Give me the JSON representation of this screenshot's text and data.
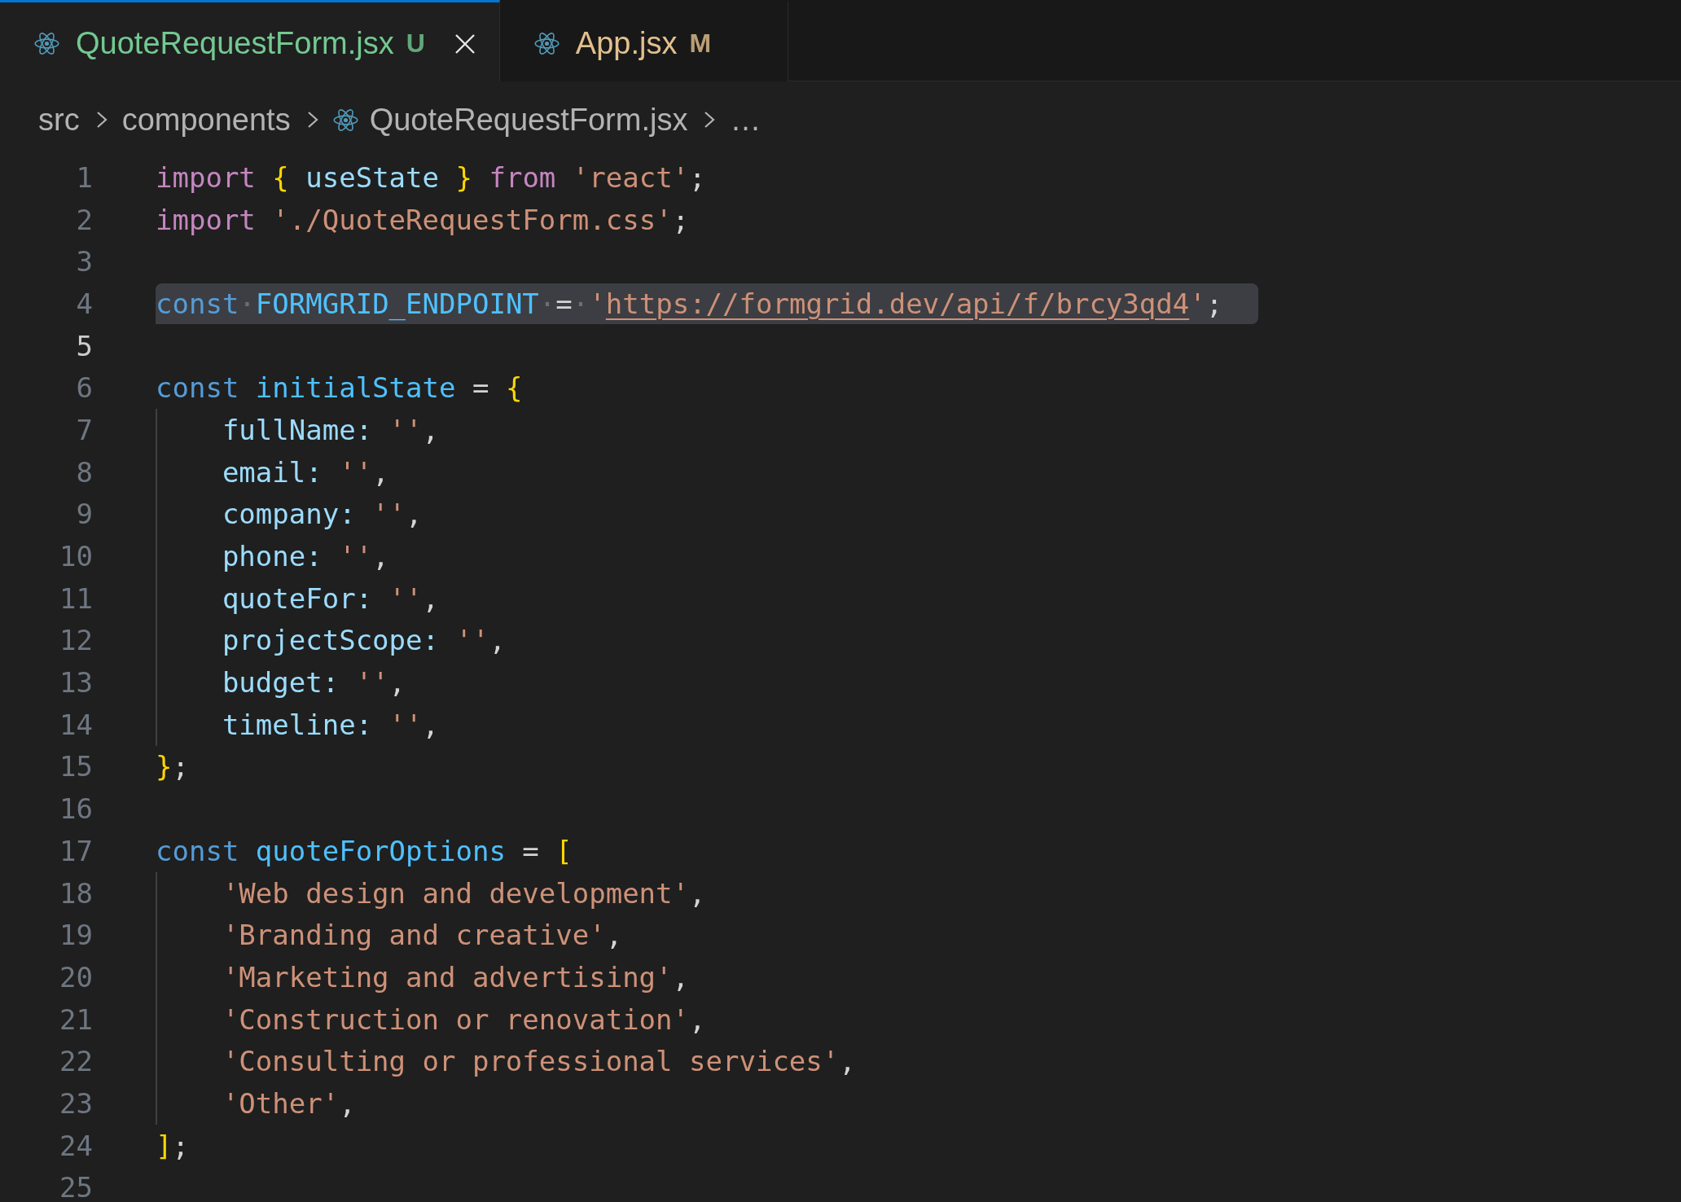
{
  "tabs": [
    {
      "label": "QuoteRequestForm.jsx",
      "status": "U",
      "color": "#73c991",
      "selected": true
    },
    {
      "label": "App.jsx",
      "status": "M",
      "color": "#e2c08d",
      "selected": false
    }
  ],
  "breadcrumb": {
    "items": [
      {
        "kind": "folder",
        "label": "src"
      },
      {
        "kind": "folder",
        "label": "components"
      },
      {
        "kind": "file",
        "label": "QuoteRequestForm.jsx"
      },
      {
        "kind": "symbol",
        "label": "…"
      }
    ]
  },
  "editor": {
    "lines": [
      {
        "number": "1",
        "selected": false,
        "active": false,
        "tokens": [
          {
            "kind": "keyword",
            "text": "import "
          },
          {
            "kind": "brace",
            "text": "{ "
          },
          {
            "kind": "variable",
            "text": "useState "
          },
          {
            "kind": "brace",
            "text": "} "
          },
          {
            "kind": "keyword",
            "text": "from "
          },
          {
            "kind": "string",
            "text": "'react'"
          },
          {
            "kind": "punct",
            "text": ";"
          }
        ]
      },
      {
        "number": "2",
        "selected": false,
        "active": false,
        "tokens": [
          {
            "kind": "keyword",
            "text": "import "
          },
          {
            "kind": "string",
            "text": "'./QuoteRequestForm.css'"
          },
          {
            "kind": "punct",
            "text": ";"
          }
        ]
      },
      {
        "number": "3",
        "selected": false,
        "active": false
      },
      {
        "number": "4",
        "selected": true,
        "active": false,
        "tokens": [
          {
            "kind": "storage",
            "text": "const"
          },
          {
            "kind": "whitespace",
            "text": "·"
          },
          {
            "kind": "constant",
            "text": "FORMGRID_ENDPOINT"
          },
          {
            "kind": "whitespace",
            "text": "·"
          },
          {
            "kind": "punct",
            "text": "="
          },
          {
            "kind": "whitespace",
            "text": "·"
          },
          {
            "kind": "string",
            "text": "'"
          },
          {
            "kind": "link",
            "text": "https://formgrid.dev/api/f/brcy3qd4"
          },
          {
            "kind": "string",
            "text": "'"
          },
          {
            "kind": "punct",
            "text": ";"
          }
        ]
      },
      {
        "number": "5",
        "selected": false,
        "active": true
      },
      {
        "number": "6",
        "selected": false,
        "active": false,
        "tokens": [
          {
            "kind": "storage",
            "text": "const "
          },
          {
            "kind": "constant",
            "text": "initialState"
          },
          {
            "kind": "punct",
            "text": " = "
          },
          {
            "kind": "brace",
            "text": "{"
          }
        ]
      },
      {
        "number": "7",
        "selected": false,
        "active": false,
        "tokens": [
          {
            "kind": "property",
            "text": "    fullName: "
          },
          {
            "kind": "string",
            "text": "''"
          },
          {
            "kind": "punct",
            "text": ","
          }
        ]
      },
      {
        "number": "8",
        "selected": false,
        "active": false,
        "tokens": [
          {
            "kind": "property",
            "text": "    email: "
          },
          {
            "kind": "string",
            "text": "''"
          },
          {
            "kind": "punct",
            "text": ","
          }
        ]
      },
      {
        "number": "9",
        "selected": false,
        "active": false,
        "tokens": [
          {
            "kind": "property",
            "text": "    company: "
          },
          {
            "kind": "string",
            "text": "''"
          },
          {
            "kind": "punct",
            "text": ","
          }
        ]
      },
      {
        "number": "10",
        "selected": false,
        "active": false,
        "tokens": [
          {
            "kind": "property",
            "text": "    phone: "
          },
          {
            "kind": "string",
            "text": "''"
          },
          {
            "kind": "punct",
            "text": ","
          }
        ]
      },
      {
        "number": "11",
        "selected": false,
        "active": false,
        "tokens": [
          {
            "kind": "property",
            "text": "    quoteFor: "
          },
          {
            "kind": "string",
            "text": "''"
          },
          {
            "kind": "punct",
            "text": ","
          }
        ]
      },
      {
        "number": "12",
        "selected": false,
        "active": false,
        "tokens": [
          {
            "kind": "property",
            "text": "    projectScope: "
          },
          {
            "kind": "string",
            "text": "''"
          },
          {
            "kind": "punct",
            "text": ","
          }
        ]
      },
      {
        "number": "13",
        "selected": false,
        "active": false,
        "tokens": [
          {
            "kind": "property",
            "text": "    budget: "
          },
          {
            "kind": "string",
            "text": "''"
          },
          {
            "kind": "punct",
            "text": ","
          }
        ]
      },
      {
        "number": "14",
        "selected": false,
        "active": false,
        "tokens": [
          {
            "kind": "property",
            "text": "    timeline: "
          },
          {
            "kind": "string",
            "text": "''"
          },
          {
            "kind": "punct",
            "text": ","
          }
        ]
      },
      {
        "number": "15",
        "selected": false,
        "active": false,
        "tokens": [
          {
            "kind": "brace",
            "text": "}"
          },
          {
            "kind": "punct",
            "text": ";"
          }
        ]
      },
      {
        "number": "16",
        "selected": false,
        "active": false
      },
      {
        "number": "17",
        "selected": false,
        "active": false,
        "tokens": [
          {
            "kind": "storage",
            "text": "const "
          },
          {
            "kind": "constant",
            "text": "quoteForOptions"
          },
          {
            "kind": "punct",
            "text": " = "
          },
          {
            "kind": "brace",
            "text": "["
          }
        ]
      },
      {
        "number": "18",
        "selected": false,
        "active": false,
        "tokens": [
          {
            "kind": "string",
            "text": "    'Web design and development'"
          },
          {
            "kind": "punct",
            "text": ","
          }
        ]
      },
      {
        "number": "19",
        "selected": false,
        "active": false,
        "tokens": [
          {
            "kind": "string",
            "text": "    'Branding and creative'"
          },
          {
            "kind": "punct",
            "text": ","
          }
        ]
      },
      {
        "number": "20",
        "selected": false,
        "active": false,
        "tokens": [
          {
            "kind": "string",
            "text": "    'Marketing and advertising'"
          },
          {
            "kind": "punct",
            "text": ","
          }
        ]
      },
      {
        "number": "21",
        "selected": false,
        "active": false,
        "tokens": [
          {
            "kind": "string",
            "text": "    'Construction or renovation'"
          },
          {
            "kind": "punct",
            "text": ","
          }
        ]
      },
      {
        "number": "22",
        "selected": false,
        "active": false,
        "tokens": [
          {
            "kind": "string",
            "text": "    'Consulting or professional services'"
          },
          {
            "kind": "punct",
            "text": ","
          }
        ]
      },
      {
        "number": "23",
        "selected": false,
        "active": false,
        "tokens": [
          {
            "kind": "string",
            "text": "    'Other'"
          },
          {
            "kind": "punct",
            "text": ","
          }
        ]
      },
      {
        "number": "24",
        "selected": false,
        "active": false,
        "tokens": [
          {
            "kind": "brace",
            "text": "]"
          },
          {
            "kind": "punct",
            "text": ";"
          }
        ]
      },
      {
        "number": "25",
        "selected": false,
        "active": false
      }
    ]
  }
}
